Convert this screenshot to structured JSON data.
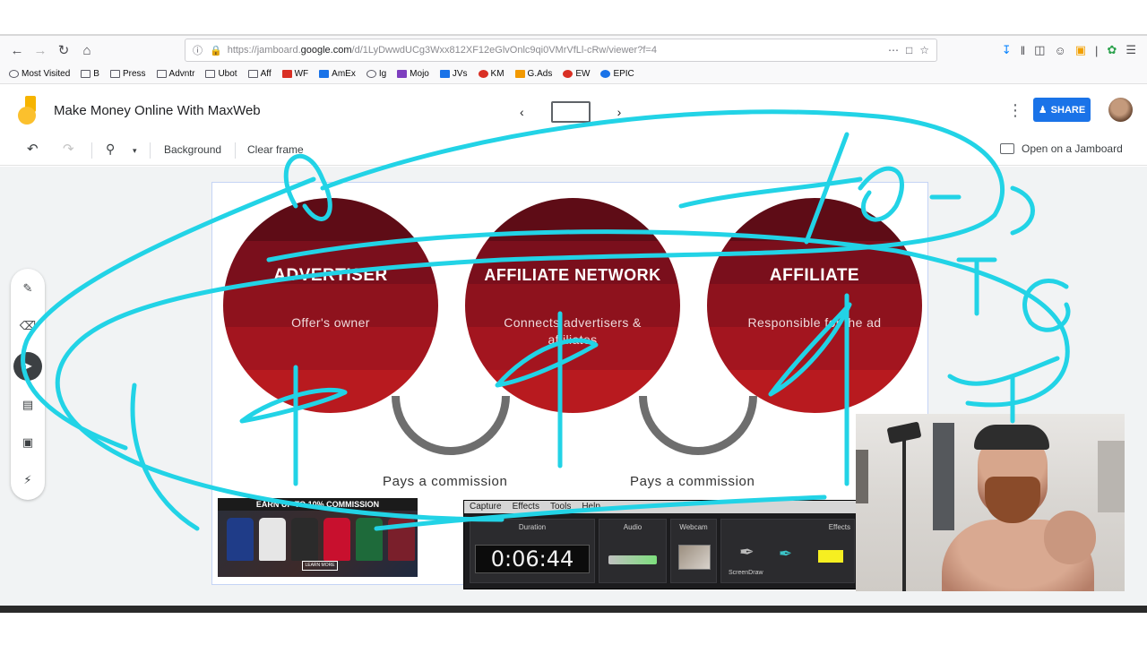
{
  "browser": {
    "url_prefix": "https://jamboard.",
    "url_host": "google.com",
    "url_path": "/d/1LyDwwdUCg3Wxx812XF12eGlvOnlc9qi0VMrVfLl-cRw/viewer?f=4",
    "bookmarks": [
      {
        "label": "Most Visited",
        "icon": "gear-icon"
      },
      {
        "label": "B",
        "icon": "folder-icon"
      },
      {
        "label": "Press",
        "icon": "folder-icon"
      },
      {
        "label": "Advntr",
        "icon": "folder-icon"
      },
      {
        "label": "Ubot",
        "icon": "folder-icon"
      },
      {
        "label": "Aff",
        "icon": "folder-icon"
      },
      {
        "label": "WF",
        "icon": "wf-icon"
      },
      {
        "label": "AmEx",
        "icon": "amex-icon"
      },
      {
        "label": "Ig",
        "icon": "globe-icon"
      },
      {
        "label": "Mojo",
        "icon": "mojo-icon"
      },
      {
        "label": "JVs",
        "icon": "jvs-icon"
      },
      {
        "label": "KM",
        "icon": "km-icon"
      },
      {
        "label": "G.Ads",
        "icon": "gads-icon"
      },
      {
        "label": "EW",
        "icon": "ew-icon"
      },
      {
        "label": "EPIC",
        "icon": "facebook-icon"
      }
    ]
  },
  "jamboard": {
    "title": "Make Money Online With MaxWeb",
    "share_label": "SHARE",
    "tools": {
      "background": "Background",
      "clear_frame": "Clear frame",
      "open_on_jamboard": "Open on a Jamboard"
    }
  },
  "slide": {
    "circles": [
      {
        "title": "ADVERTISER",
        "subtitle": "Offer's owner"
      },
      {
        "title": "AFFILIATE NETWORK",
        "subtitle": "Connects advertisers & affiliates"
      },
      {
        "title": "AFFILIATE",
        "subtitle": "Responsible for the ad"
      }
    ],
    "commission_left": "Pays a commission",
    "commission_right": "Pays a commission"
  },
  "ad_banner": {
    "headline": "EARN UP TO 10% COMMISSION",
    "button": "LEARN MORE"
  },
  "recorder": {
    "menu": [
      "Capture",
      "Effects",
      "Tools",
      "Help"
    ],
    "duration_label": "Duration",
    "duration": "0:06:44",
    "audio_label": "Audio",
    "webcam_label": "Webcam",
    "effects_label": "Effects",
    "screendraw_label": "ScreenDraw"
  },
  "colors": {
    "scribble": "#22d3e6",
    "share": "#1a73e8",
    "circle_dark": "#5e0c16",
    "circle_light": "#b81a1f"
  }
}
